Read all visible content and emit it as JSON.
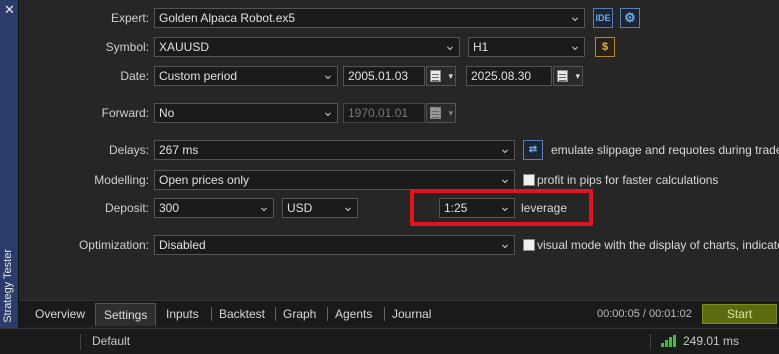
{
  "sidebar": {
    "close": "✕",
    "title": "Strategy Tester"
  },
  "form": {
    "expert": {
      "label": "Expert:",
      "value": "Golden Alpaca Robot.ex5",
      "ide": "IDE"
    },
    "symbol": {
      "label": "Symbol:",
      "value": "XAUUSD",
      "timeframe": "H1"
    },
    "date": {
      "label": "Date:",
      "value": "Custom period",
      "from": "2005.01.03",
      "to": "2025.08.30"
    },
    "forward": {
      "label": "Forward:",
      "value": "No",
      "date": "1970.01.01"
    },
    "delays": {
      "label": "Delays:",
      "value": "267 ms",
      "note": "emulate slippage and requotes during trade"
    },
    "modelling": {
      "label": "Modelling:",
      "value": "Open prices only",
      "note": "profit in pips for faster calculations"
    },
    "deposit": {
      "label": "Deposit:",
      "value": "300",
      "currency": "USD",
      "leverage": "1:25",
      "leverage_label": "leverage"
    },
    "optimization": {
      "label": "Optimization:",
      "value": "Disabled",
      "note": "visual mode with the display of charts, indicato"
    }
  },
  "tabs": [
    "Overview",
    "Settings",
    "Inputs",
    "Backtest",
    "Graph",
    "Agents",
    "Journal"
  ],
  "active_tab": "Settings",
  "timer": "00:00:05 / 00:01:02",
  "start_label": "Start",
  "status": {
    "profile": "Default",
    "ping": "249.01 ms"
  },
  "colors": {
    "highlight": "#e0141e",
    "start_button": "#5d6b10",
    "signal": "#3fbf3f"
  }
}
